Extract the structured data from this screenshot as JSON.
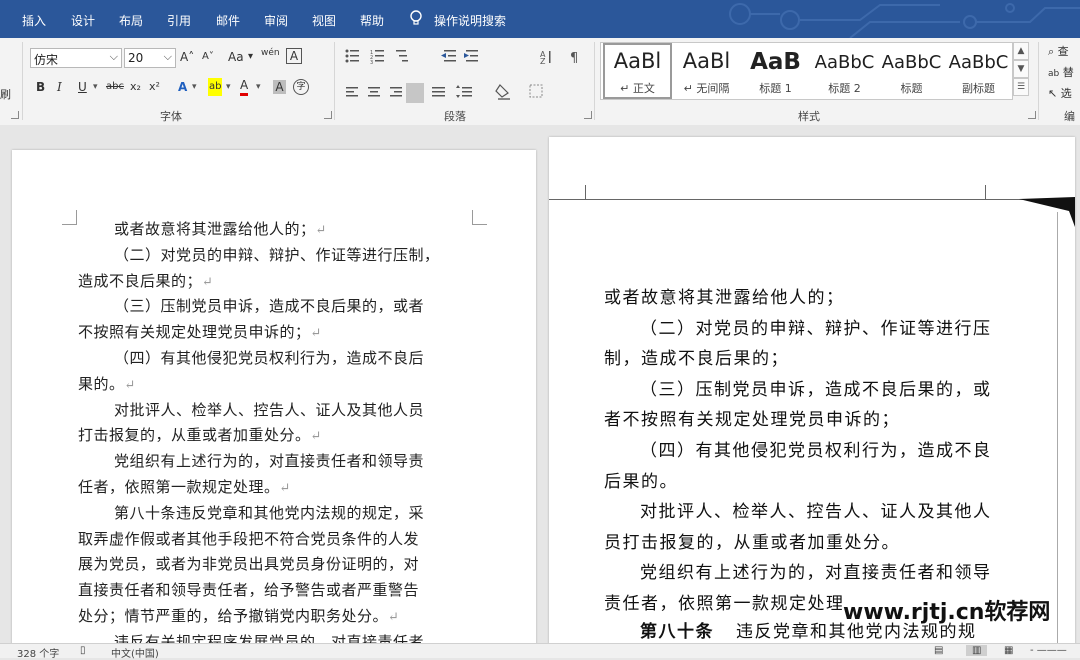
{
  "tabs": [
    "插入",
    "设计",
    "布局",
    "引用",
    "邮件",
    "审阅",
    "视图",
    "帮助"
  ],
  "tell_me": "操作说明搜索",
  "ribbon": {
    "font_name": "仿宋",
    "font_size": "20",
    "group_labels": {
      "font": "字体",
      "paragraph": "段落",
      "styles": "样式",
      "editing": "编辑"
    },
    "font_buttons": {
      "bold": "B",
      "italic": "I",
      "underline": "U",
      "strike": "abc",
      "subscript": "x₂",
      "superscript": "x²",
      "grow": "A˄",
      "shrink": "A˅",
      "case": "Aa",
      "phonetic": "wén",
      "border_char": "A",
      "text_effect": "A",
      "highlight": "ab",
      "font_color": "A",
      "char_shade": "A",
      "enclose": "字"
    },
    "styles": [
      {
        "sample": "AaBl",
        "name": "↵ 正文"
      },
      {
        "sample": "AaBl",
        "name": "↵ 无间隔"
      },
      {
        "sample": "AaB",
        "name": "标题 1"
      },
      {
        "sample": "AaBbC",
        "name": "标题 2"
      },
      {
        "sample": "AaBbC",
        "name": "标题"
      },
      {
        "sample": "AaBbC",
        "name": "副标题"
      }
    ],
    "editing": [
      "查",
      "替",
      "选"
    ]
  },
  "left_page_lines": [
    {
      "text": "或者故意将其泄露给他人的；",
      "indent": true
    },
    {
      "text": "（二）对党员的申辩、辩护、作证等进行压制，",
      "indent": true
    },
    {
      "text": "造成不良后果的；",
      "indent": false
    },
    {
      "text": "（三）压制党员申诉，造成不良后果的，或者",
      "indent": true
    },
    {
      "text": "不按照有关规定处理党员申诉的；",
      "indent": false
    },
    {
      "text": "（四）有其他侵犯党员权利行为，造成不良后",
      "indent": true
    },
    {
      "text": "果的。",
      "indent": false
    },
    {
      "text": "对批评人、检举人、控告人、证人及其他人员",
      "indent": true
    },
    {
      "text": "打击报复的，从重或者加重处分。",
      "indent": false
    },
    {
      "text": "党组织有上述行为的，对直接责任者和领导责",
      "indent": true
    },
    {
      "text": "任者，依照第一款规定处理。",
      "indent": false
    },
    {
      "text": "第八十条违反党章和其他党内法规的规定，采",
      "indent": true
    },
    {
      "text": "取弄虚作假或者其他手段把不符合党员条件的人发",
      "indent": false
    },
    {
      "text": "展为党员，或者为非党员出具党员身份证明的，对",
      "indent": false
    },
    {
      "text": "直接责任者和领导责任者，给予警告或者严重警告",
      "indent": false
    },
    {
      "text": "处分；情节严重的，给予撤销党内职务处分。",
      "indent": false
    },
    {
      "text": "违反有关规定程序发展党员的，对直接责任者",
      "indent": true
    }
  ],
  "para_mark": "↵",
  "right_page_lines": [
    {
      "text": "或者故意将其泄露给他人的；",
      "indent": false
    },
    {
      "text": "（二）对党员的申辩、辩护、作证等进行压",
      "indent": true
    },
    {
      "text": "制，造成不良后果的；",
      "indent": false
    },
    {
      "text": "（三）压制党员申诉，造成不良后果的，或",
      "indent": true
    },
    {
      "text": "者不按照有关规定处理党员申诉的；",
      "indent": false
    },
    {
      "text": "（四）有其他侵犯党员权利行为，造成不良",
      "indent": true
    },
    {
      "text": "后果的。",
      "indent": false
    },
    {
      "text": "对批评人、检举人、控告人、证人及其他人",
      "indent": true
    },
    {
      "text": "员打击报复的，从重或者加重处分。",
      "indent": false
    },
    {
      "text": "党组织有上述行为的，对直接责任者和领导",
      "indent": true
    },
    {
      "text": "责任者，依照第一款规定处理",
      "indent": false
    }
  ],
  "right_article_label": "第八十条",
  "right_article_text": "违反党章和其他党内法规的规",
  "watermark": "www.rjtj.cn软荐网",
  "status": {
    "words": "328 个字",
    "language": "中文(中国)"
  }
}
